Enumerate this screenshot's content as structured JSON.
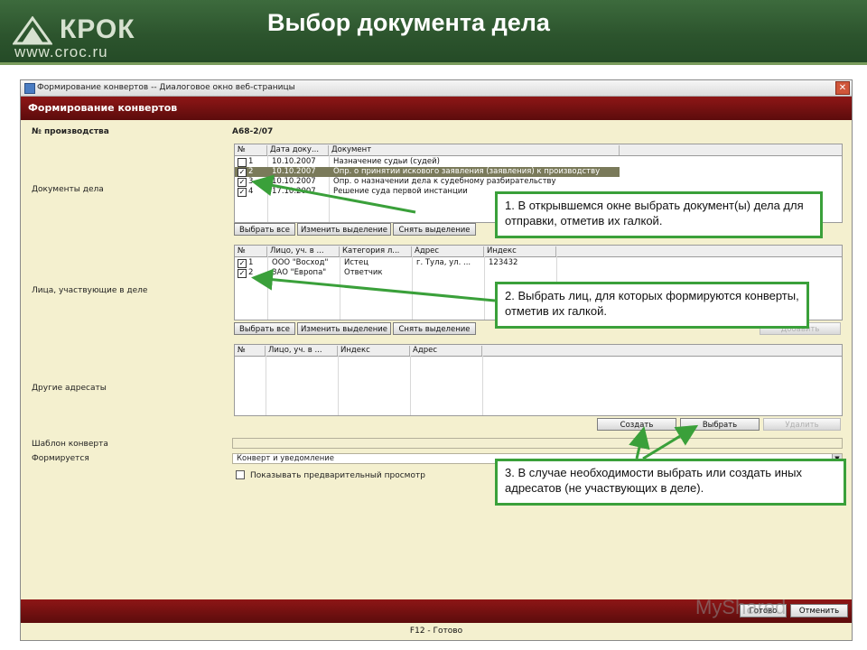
{
  "slide": {
    "title": "Выбор документа дела",
    "logo_word": "КРОК",
    "logo_url": "www.croc.ru"
  },
  "window": {
    "titlebar": "Формирование конвертов -- Диалоговое окно веб-страницы",
    "close": "✕",
    "header": "Формирование конвертов"
  },
  "form": {
    "case_label": "№ производства",
    "case_value": "А68-2/07",
    "docs_label": "Документы дела",
    "persons_label": "Лица, участвующие в деле",
    "others_label": "Другие адресаты",
    "template_label": "Шаблон конверта",
    "forms_label": "Формируется",
    "forms_value": "Конверт и уведомление",
    "preview_label": "Показывать предварительный просмотр"
  },
  "docs_grid": {
    "headers": [
      "№",
      "Дата доку...",
      "Документ"
    ],
    "rows": [
      {
        "checked": false,
        "no": "1",
        "date": "10.10.2007",
        "doc": "Назначение судьи (судей)",
        "selected": false
      },
      {
        "checked": true,
        "no": "2",
        "date": "10.10.2007",
        "doc": "Опр. о принятии искового заявления (заявления) к производству",
        "selected": true
      },
      {
        "checked": true,
        "no": "3",
        "date": "10.10.2007",
        "doc": "Опр. о назначении дела к судебному разбирательству",
        "selected": false
      },
      {
        "checked": true,
        "no": "4",
        "date": "17.10.2007",
        "doc": "Решение суда первой инстанции",
        "selected": false
      }
    ],
    "buttons": [
      "Выбрать все",
      "Изменить выделение",
      "Снять выделение"
    ]
  },
  "persons_grid": {
    "headers": [
      "№",
      "Лицо, уч. в ...",
      "Категория л...",
      "Адрес",
      "Индекс"
    ],
    "rows": [
      {
        "checked": true,
        "no": "1",
        "name": "ООО \"Восход\"",
        "cat": "Истец",
        "addr": "г. Тула, ул. ...",
        "index": "123432"
      },
      {
        "checked": true,
        "no": "2",
        "name": "ЗАО \"Европа\"",
        "cat": "Ответчик",
        "addr": "",
        "index": ""
      }
    ],
    "buttons": [
      "Выбрать все",
      "Изменить выделение",
      "Снять выделение"
    ],
    "hidden_button": "Добавить"
  },
  "others_grid": {
    "headers": [
      "№",
      "Лицо, уч. в ...",
      "Индекс",
      "Адрес"
    ],
    "buttons": [
      "Создать",
      "Выбрать",
      "Удалить"
    ]
  },
  "callouts": {
    "c1": "1. В открывшемся окне выбрать документ(ы) дела для отправки, отметив их галкой.",
    "c2": "2. Выбрать лиц, для которых формируются конверты, отметив их галкой.",
    "c3": "3. В случае необходимости выбрать или создать иных адресатов (не участвующих в деле)."
  },
  "footer": {
    "ok": "Готово",
    "cancel": "Отменить",
    "status": "F12 - Готово"
  },
  "watermark": "MyShared",
  "colors": {
    "banner": "#2c542d",
    "window_bg": "#f4f0cf",
    "header": "#7a1212",
    "callout_border": "#3aa03a"
  }
}
